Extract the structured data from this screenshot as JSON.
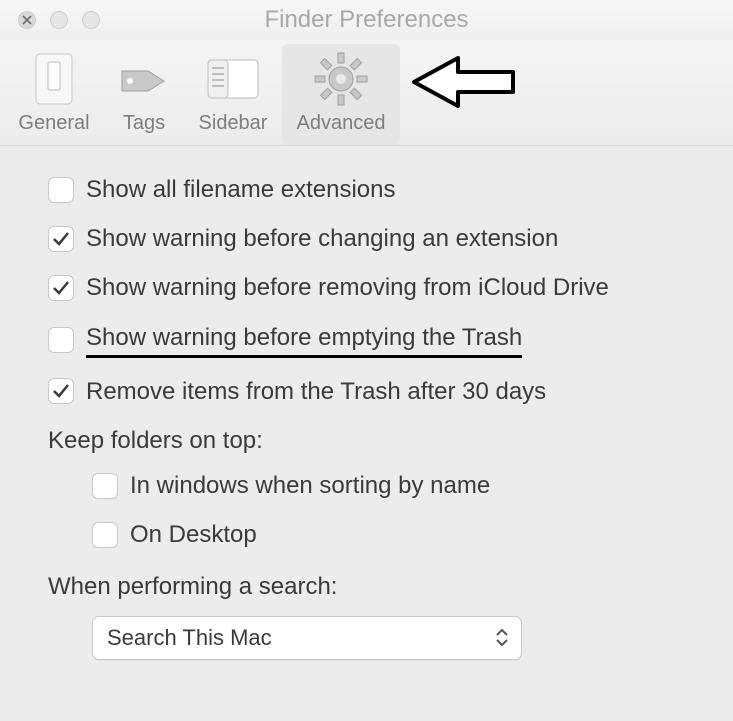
{
  "window": {
    "title": "Finder Preferences"
  },
  "toolbar": {
    "tabs": {
      "general": "General",
      "tags": "Tags",
      "sidebar": "Sidebar",
      "advanced": "Advanced"
    },
    "selected": "Advanced"
  },
  "options": {
    "show_extensions": {
      "label": "Show all filename extensions",
      "checked": false
    },
    "warn_change_ext": {
      "label": "Show warning before changing an extension",
      "checked": true
    },
    "warn_icloud_remove": {
      "label": "Show warning before removing from iCloud Drive",
      "checked": true
    },
    "warn_empty_trash": {
      "label": "Show warning before emptying the Trash",
      "checked": false
    },
    "auto_remove_trash": {
      "label": "Remove items from the Trash after 30 days",
      "checked": true
    }
  },
  "folders_on_top": {
    "label": "Keep folders on top:",
    "in_windows": {
      "label": "In windows when sorting by name",
      "checked": false
    },
    "on_desktop": {
      "label": "On Desktop",
      "checked": false
    }
  },
  "search": {
    "label": "When performing a search:",
    "selected": "Search This Mac"
  }
}
